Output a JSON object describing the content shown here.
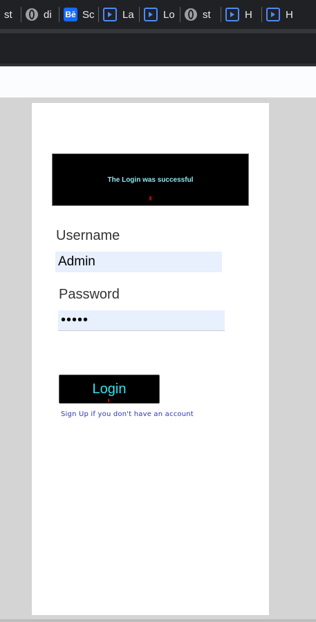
{
  "bookmarks": [
    {
      "icon": "none",
      "label": "st"
    },
    {
      "icon": "globe-icon",
      "label": "di"
    },
    {
      "icon": "behance-icon",
      "badge": "Bē",
      "label": "Sc"
    },
    {
      "icon": "play-icon",
      "label": "La"
    },
    {
      "icon": "play-icon",
      "label": "Lo"
    },
    {
      "icon": "globe-icon",
      "label": "st"
    },
    {
      "icon": "play-icon",
      "label": "H"
    },
    {
      "icon": "play-icon",
      "label": "H"
    }
  ],
  "login": {
    "banner_message": "The Login was successful",
    "username_label": "Username",
    "username_value": "Admin",
    "password_label": "Password",
    "password_value": "•••••",
    "login_button": "Login",
    "signup_link": "Sign Up if you don't have an account"
  },
  "colors": {
    "banner_text": "#8ee8ee",
    "button_text": "#34e3f0",
    "link": "#2a36b8",
    "input_bg": "#e8f0fe"
  }
}
